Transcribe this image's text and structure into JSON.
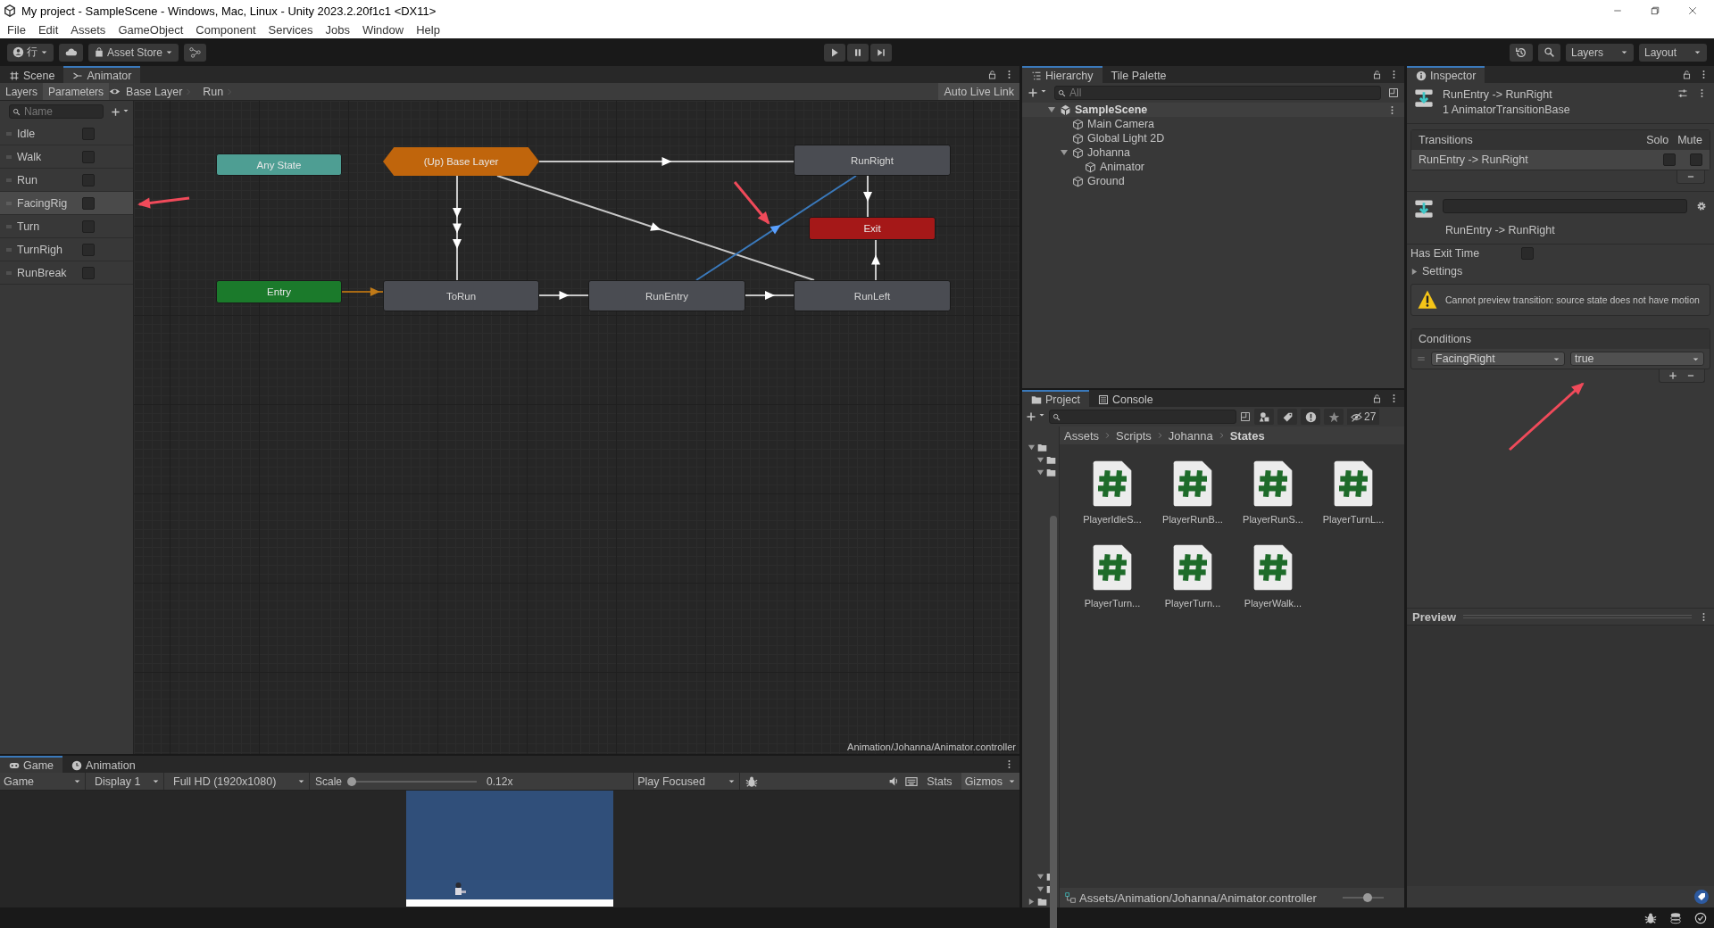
{
  "window": {
    "title": "My project - SampleScene - Windows, Mac, Linux - Unity 2023.2.20f1c1 <DX11>"
  },
  "menu": [
    "File",
    "Edit",
    "Assets",
    "GameObject",
    "Component",
    "Services",
    "Jobs",
    "Window",
    "Help"
  ],
  "toolbar": {
    "account": "行",
    "asset_store": "Asset Store",
    "layers": "Layers",
    "layout": "Layout"
  },
  "animator": {
    "tabs": [
      {
        "label": "Scene",
        "selected": false
      },
      {
        "label": "Animator",
        "selected": true
      }
    ],
    "sidebar_tabs": [
      {
        "label": "Layers",
        "selected": false
      },
      {
        "label": "Parameters",
        "selected": true
      }
    ],
    "breadcrumb": [
      "Base Layer",
      "Run"
    ],
    "auto_live_link": "Auto Live Link",
    "search": {
      "placeholder": "Name"
    },
    "parameters": [
      {
        "name": "Idle",
        "checked": false,
        "selected": false
      },
      {
        "name": "Walk",
        "checked": false,
        "selected": false
      },
      {
        "name": "Run",
        "checked": false,
        "selected": false
      },
      {
        "name": "FacingRig",
        "checked": false,
        "selected": true
      },
      {
        "name": "Turn",
        "checked": false,
        "selected": false
      },
      {
        "name": "TurnRigh",
        "checked": false,
        "selected": false
      },
      {
        "name": "RunBreak",
        "checked": false,
        "selected": false
      }
    ],
    "states": [
      {
        "label": "Any State",
        "kind": "any"
      },
      {
        "label": "(Up) Base Layer",
        "kind": "layer"
      },
      {
        "label": "RunRight",
        "kind": "state"
      },
      {
        "label": "Exit",
        "kind": "exit"
      },
      {
        "label": "Entry",
        "kind": "entry"
      },
      {
        "label": "ToRun",
        "kind": "state"
      },
      {
        "label": "RunEntry",
        "kind": "state"
      },
      {
        "label": "RunLeft",
        "kind": "state"
      }
    ],
    "transitions": [
      {
        "kind": "normal",
        "selected": false
      },
      {
        "kind": "normal",
        "selected": false
      },
      {
        "kind": "normal",
        "selected": false
      },
      {
        "kind": "normal",
        "selected": true
      },
      {
        "kind": "normal",
        "selected": false
      },
      {
        "kind": "normal",
        "selected": false
      },
      {
        "kind": "default",
        "selected": false
      },
      {
        "kind": "normal",
        "selected": false
      },
      {
        "kind": "normal",
        "selected": false
      }
    ],
    "footer_path": "Animation/Johanna/Animator.controller"
  },
  "game": {
    "tabs": [
      {
        "label": "Game",
        "selected": true
      },
      {
        "label": "Animation",
        "selected": false
      }
    ],
    "view_dropdown": "Game",
    "display_dropdown": "Display 1",
    "resolution_dropdown": "Full HD (1920x1080)",
    "scale": {
      "label": "Scale",
      "level": 0.0,
      "reading": "0.12x"
    },
    "play_mode_dropdown": "Play Focused",
    "stats": "Stats",
    "gizmos": "Gizmos"
  },
  "hierarchy": {
    "tabs": [
      {
        "label": "Hierarchy",
        "selected": true
      },
      {
        "label": "Tile Palette",
        "selected": false
      }
    ],
    "search": {
      "placeholder": "All"
    },
    "tree": [
      {
        "label": "SampleScene",
        "kind": "scene",
        "expanded": true,
        "children": [
          {
            "label": "Main Camera",
            "kind": "object"
          },
          {
            "label": "Global Light 2D",
            "kind": "object"
          },
          {
            "label": "Johanna",
            "kind": "object",
            "expanded": true,
            "children": [
              {
                "label": "Animator",
                "kind": "object"
              }
            ]
          },
          {
            "label": "Ground",
            "kind": "object"
          }
        ]
      }
    ]
  },
  "project": {
    "tabs": [
      {
        "label": "Project",
        "selected": true
      },
      {
        "label": "Console",
        "selected": false
      }
    ],
    "hidden_count": "27",
    "breadcrumb": [
      "Assets",
      "Scripts",
      "Johanna",
      "States"
    ],
    "files": [
      "PlayerIdleS...",
      "PlayerRunB...",
      "PlayerRunS...",
      "PlayerTurnL...",
      "PlayerTurn...",
      "PlayerTurn...",
      "PlayerWalk..."
    ],
    "footer_path": "Assets/Animation/Johanna/Animator.controller",
    "icon_size": {
      "level": 0.6
    }
  },
  "inspector": {
    "tabs": [
      {
        "label": "Inspector",
        "selected": true
      }
    ],
    "title": "RunEntry -> RunRight",
    "subtitle": "1 AnimatorTransitionBase",
    "transitions": {
      "header": "Transitions",
      "solo_header": "Solo",
      "mute_header": "Mute",
      "rows": [
        {
          "label": "RunEntry -> RunRight",
          "solo": false,
          "mute": false,
          "selected": true
        }
      ]
    },
    "transition_label": "RunEntry -> RunRight",
    "has_exit_time": {
      "label": "Has Exit Time",
      "checked": false
    },
    "settings": {
      "label": "Settings",
      "expanded": false
    },
    "warning": "Cannot preview transition: source state does not have motion",
    "conditions": {
      "header": "Conditions",
      "rows": [
        {
          "parameter": "FacingRight",
          "value": "true"
        }
      ]
    },
    "preview": "Preview"
  }
}
